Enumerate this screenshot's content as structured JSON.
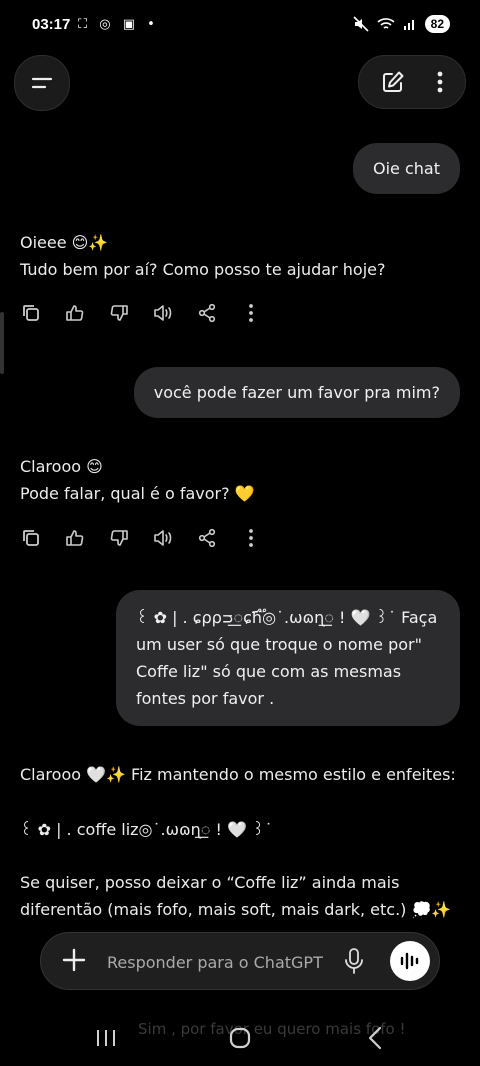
{
  "status": {
    "time": "03:17",
    "left_icons": "⛶ ◎ ▣ •",
    "battery": "82"
  },
  "messages": {
    "user1": "Oie chat",
    "ai1": "Oieee 😊✨\nTudo bem por aí? Como posso te ajudar hoje?",
    "user2": "você pode fazer um favor pra mim?",
    "ai2": "Clarooo 😊\nPode falar, qual é o favor? 💛",
    "user3": "꒰ ✿ | . ɕ⍴⍴ᴝ꯭ɕɦ֟፝◎˙.ωɷɳ꯭ ! 🤍 ꒱˙ Faça um user só que troque o nome por\" Coffe liz\" só que com as mesmas fontes por favor .",
    "ai3_line1": "Clarooo 🤍✨ Fiz mantendo o mesmo estilo e enfeites:",
    "ai3_line2": "꒰ ✿ | . coffe liz◎˙.ωɷɳ꯭ ! 🤍 ꒱˙",
    "ai3_line3": "Se quiser, posso deixar o “Coffe liz” ainda mais diferentão (mais fofo, mais soft, mais dark, etc.) 💭✨"
  },
  "composer": {
    "placeholder": "Responder para o ChatGPT"
  },
  "suggestion_faded": "Sim , por favor eu quero mais fofo !"
}
